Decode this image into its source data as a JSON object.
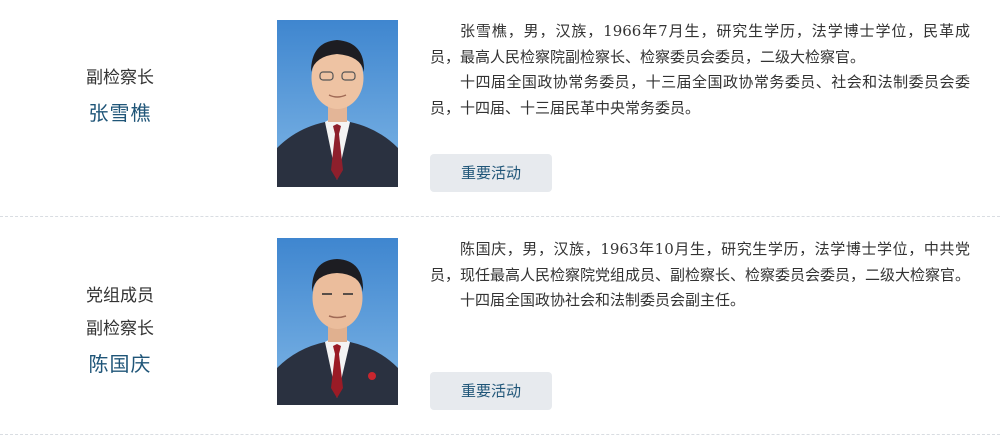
{
  "leaders": [
    {
      "titles": [
        "副检察长"
      ],
      "name": "张雪樵",
      "bio": [
        "张雪樵，男，汉族，1966年7月生，研究生学历，法学博士学位，民革成员，最高人民检察院副检察长、检察委员会委员，二级大检察官。",
        "十四届全国政协常务委员，十三届全国政协常务委员、社会和法制委员会委员，十四届、十三届民革中央常务委员。"
      ],
      "button_label": "重要活动"
    },
    {
      "titles": [
        "党组成员",
        "副检察长"
      ],
      "name": "陈国庆",
      "bio": [
        "陈国庆，男，汉族，1963年10月生，研究生学历，法学博士学位，中共党员，现任最高人民检察院党组成员、副检察长、检察委员会委员，二级大检察官。",
        "十四届全国政协社会和法制委员会副主任。"
      ],
      "button_label": "重要活动"
    }
  ],
  "colors": {
    "name": "#1f5578",
    "button_bg": "#e7eaee",
    "photo_bg": "#4a8fd1",
    "suit": "#2a3140",
    "tie_0": "#8e1f2c",
    "tie_1": "#9a1b26"
  }
}
